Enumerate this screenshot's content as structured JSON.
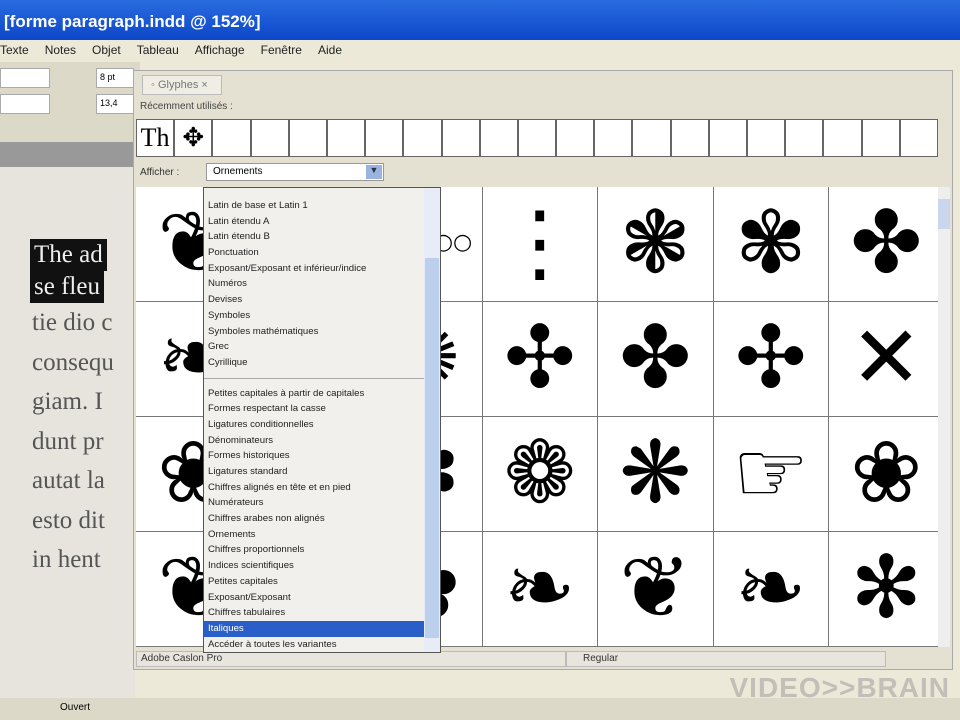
{
  "window": {
    "title": "[forme paragraph.indd @ 152%]"
  },
  "menu": [
    "Texte",
    "Notes",
    "Objet",
    "Tableau",
    "Affichage",
    "Fenêtre",
    "Aide"
  ],
  "control": {
    "size1": "8 pt",
    "size2": "13,4"
  },
  "document": {
    "lines": [
      "The ad",
      "se fleu",
      "tie dio c",
      "consequ",
      "giam. I",
      "dunt pr",
      "autat la",
      "esto dit",
      "in hent"
    ]
  },
  "glyphs_panel": {
    "tab": "Glyphes",
    "recent_label": "Récemment utilisés :",
    "recent": [
      "Th",
      "✥"
    ],
    "show_label": "Afficher :",
    "show_value": "Ornements",
    "glyphs": [
      "❦",
      "⚜",
      "○○○○○",
      "⋮",
      "❃",
      "✾",
      "✤",
      "❧",
      "✥",
      "✺",
      "✣",
      "✤",
      "✣",
      "✕",
      "❀",
      "☙",
      "✽",
      "❁",
      "❋",
      "☞",
      "❀",
      "❦",
      "❧",
      "✿",
      "❧",
      "❦",
      "❧",
      "✻"
    ],
    "font": "Adobe Caslon Pro",
    "style": "Regular"
  },
  "dropdown": {
    "group1": [
      "Latin de base et Latin 1",
      "Latin étendu A",
      "Latin étendu B",
      "Ponctuation",
      "Exposant/Exposant et inférieur/indice",
      "Numéros",
      "Devises",
      "Symboles",
      "Symboles mathématiques",
      "Grec",
      "Cyrillique"
    ],
    "group2": [
      "Petites capitales à partir de capitales",
      "Formes respectant la casse",
      "Ligatures conditionnelles",
      "Dénominateurs",
      "Formes historiques",
      "Ligatures standard",
      "Chiffres alignés en tête et en pied",
      "Numérateurs",
      "Chiffres arabes non alignés",
      "Ornements",
      "Chiffres proportionnels",
      "Indices scientifiques",
      "Petites capitales",
      "Exposant/Exposant",
      "Chiffres tabulaires"
    ],
    "selected": "Italiques",
    "last": "Accéder à toutes les variantes"
  },
  "status": {
    "view": "Ouvert"
  },
  "watermark": "VIDEO>>BRAIN"
}
